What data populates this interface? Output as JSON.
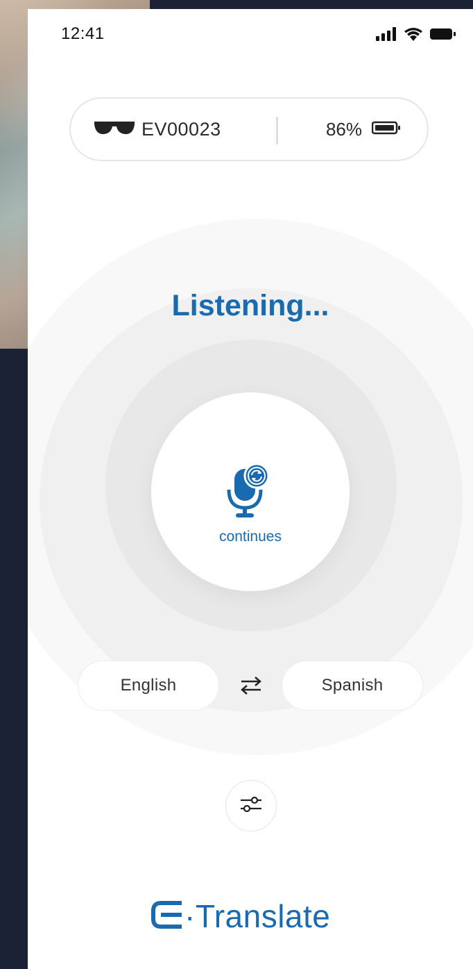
{
  "status_bar": {
    "time": "12:41",
    "icons": [
      "cellular-signal-icon",
      "wifi-icon",
      "battery-icon"
    ]
  },
  "device": {
    "icon": "glasses-icon",
    "id": "EV00023",
    "battery_percent": "86%",
    "battery_icon": "battery-icon"
  },
  "listening": {
    "status_text": "Listening...",
    "mic_icon": "microphone-sync-icon",
    "mode_label": "continues"
  },
  "languages": {
    "source": "English",
    "target": "Spanish",
    "swap_icon": "swap-arrows-icon"
  },
  "settings": {
    "icon": "sliders-icon"
  },
  "logo": {
    "text": "·Translate",
    "mark_icon": "e-logo-icon"
  },
  "colors": {
    "accent": "#1a6ab0",
    "background": "#ffffff",
    "outer_background": "#1c2236"
  }
}
